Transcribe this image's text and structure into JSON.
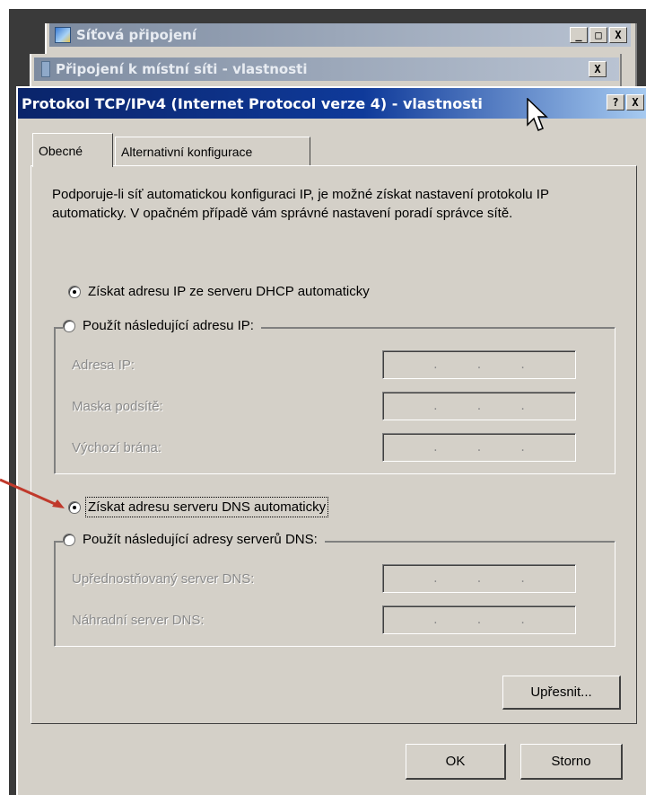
{
  "windows": {
    "network_connections": {
      "title": "Síťová připojení"
    },
    "lan_properties": {
      "title": "Připojení k místní síti - vlastnosti"
    }
  },
  "dialog": {
    "title": "Protokol TCP/IPv4 (Internet Protocol verze 4) - vlastnosti",
    "help_label": "?",
    "close_label": "X"
  },
  "titlebar_buttons": {
    "minimize": "_",
    "maximize": "□",
    "close": "X"
  },
  "tabs": [
    {
      "label": "Obecné",
      "selected": true
    },
    {
      "label": "Alternativní konfigurace",
      "selected": false
    }
  ],
  "intro_text": "Podporuje-li síť automatickou konfiguraci IP, je možné získat nastavení protokolu IP automaticky. V opačném případě vám správné nastavení poradí správce sítě.",
  "ip_section": {
    "auto_label": "Získat adresu IP ze serveru DHCP automaticky",
    "auto_selected": true,
    "manual_label": "Použít následující adresu IP:",
    "fields": [
      {
        "label": "Adresa IP:",
        "value": ". . ."
      },
      {
        "label": "Maska podsítě:",
        "value": ". . ."
      },
      {
        "label": "Výchozí brána:",
        "value": ". . ."
      }
    ]
  },
  "dns_section": {
    "auto_label": "Získat adresu serveru DNS automaticky",
    "auto_selected": true,
    "manual_label": "Použít následující adresy serverů DNS:",
    "fields": [
      {
        "label": "Upřednostňovaný server DNS:",
        "value": ". . ."
      },
      {
        "label": "Náhradní server DNS:",
        "value": ". . ."
      }
    ]
  },
  "buttons": {
    "advanced": "Upřesnit...",
    "ok": "OK",
    "cancel": "Storno"
  },
  "colors": {
    "active_title": "#0a246a",
    "face": "#d4d0c8",
    "annotation_arrow": "#c0392b"
  }
}
